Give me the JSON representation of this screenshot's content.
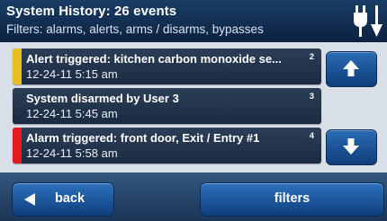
{
  "header": {
    "title": "System History: 26 events",
    "filters": "Filters: alarms, alerts, arms / disarms, bypasses",
    "power_icon": "power-plug-icon"
  },
  "events": [
    {
      "message": "Alert triggered: kitchen carbon monoxide se...",
      "time": "12-24-11 5:15 am",
      "number": "2",
      "color": "#e8c020"
    },
    {
      "message": "System disarmed by User 3",
      "time": "12-24-11 5:45 am",
      "number": "3",
      "color": ""
    },
    {
      "message": "Alarm triggered: front door, Exit / Entry #1",
      "time": "12-24-11 5:58 am",
      "number": "4",
      "color": "#e21c1c"
    }
  ],
  "scroll": {
    "up_icon": "arrow-up-icon",
    "down_icon": "arrow-down-icon"
  },
  "footer": {
    "back_label": "back",
    "back_icon": "triangle-left-icon",
    "filters_label": "filters"
  }
}
